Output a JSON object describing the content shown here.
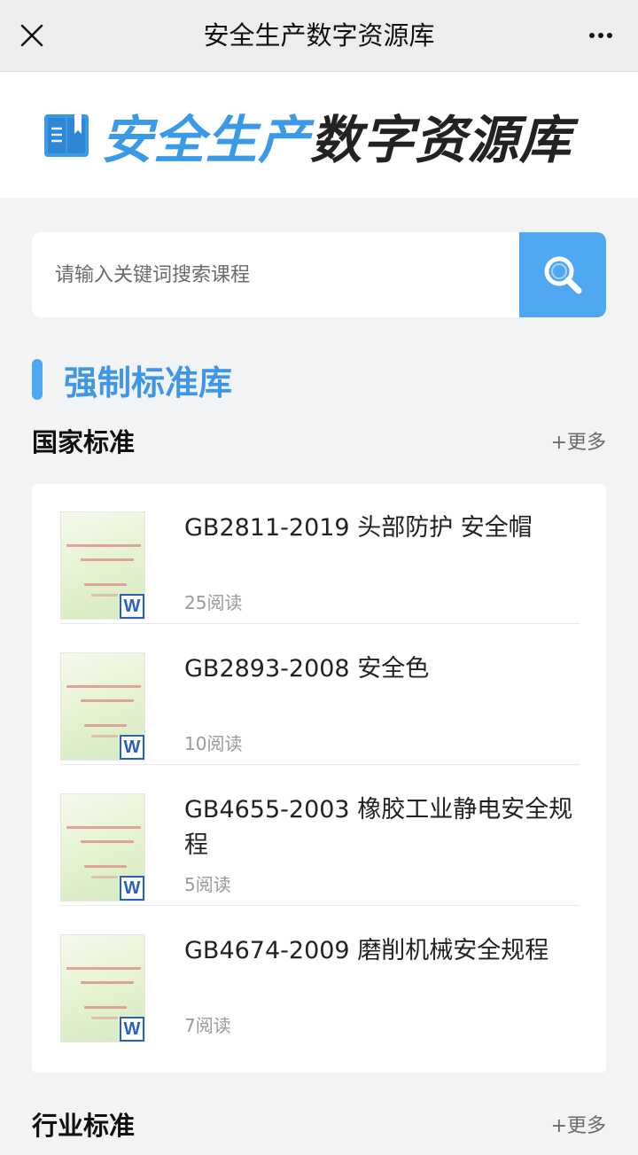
{
  "topbar": {
    "title": "安全生产数字资源库"
  },
  "banner": {
    "logo_text_blue": "安全生产",
    "logo_text_dark": "数字资源库"
  },
  "search": {
    "placeholder": "请输入关键词搜索课程"
  },
  "section": {
    "title": "强制标准库"
  },
  "national": {
    "title": "国家标准",
    "more": "+更多",
    "items": [
      {
        "name": "GB2811-2019 头部防护 安全帽",
        "reads": "25阅读"
      },
      {
        "name": "GB2893-2008 安全色",
        "reads": "10阅读"
      },
      {
        "name": "GB4655-2003 橡胶工业静电安全规程",
        "reads": "5阅读"
      },
      {
        "name": "GB4674-2009 磨削机械安全规程",
        "reads": "7阅读"
      }
    ]
  },
  "industry": {
    "title": "行业标准",
    "more": "+更多"
  },
  "colors": {
    "accent": "#4fa6f1",
    "heading_blue": "#3d97e6",
    "word_badge": "#2a62b8"
  },
  "icons": {
    "close": "close-icon",
    "more": "more-dots-icon",
    "search": "search-icon",
    "logo": "book-icon",
    "doc_type": "word-doc-icon"
  }
}
